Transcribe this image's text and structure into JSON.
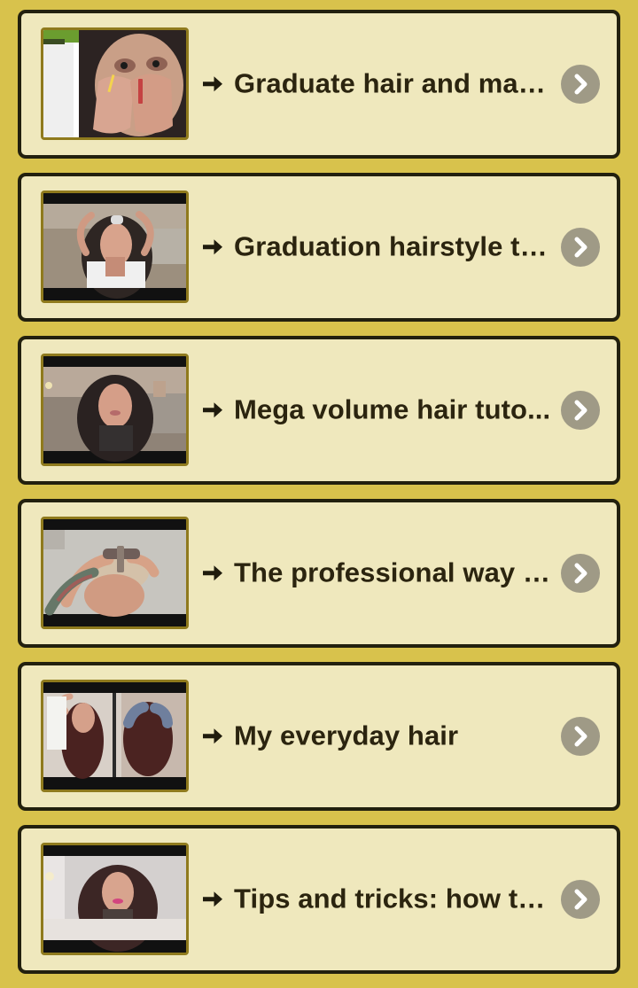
{
  "items": [
    {
      "title": "Graduate hair and mak...",
      "thumb_name": "graduate-hair-makeup-thumbnail",
      "thumb_type": "closeup"
    },
    {
      "title": "Graduation hairstyle tips",
      "thumb_name": "graduation-hairstyle-thumbnail",
      "thumb_type": "portrait"
    },
    {
      "title": "Mega volume hair tuto...",
      "thumb_name": "mega-volume-thumbnail",
      "thumb_type": "portrait"
    },
    {
      "title": "The professional way t...",
      "thumb_name": "professional-way-thumbnail",
      "thumb_type": "hands"
    },
    {
      "title": "My everyday hair",
      "thumb_name": "everyday-hair-thumbnail",
      "thumb_type": "split"
    },
    {
      "title": "Tips and tricks: how to...",
      "thumb_name": "tips-tricks-thumbnail",
      "thumb_type": "portrait"
    }
  ]
}
